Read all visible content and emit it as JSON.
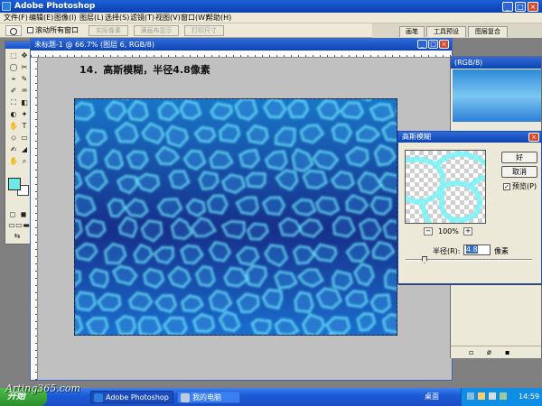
{
  "app": {
    "title": "Adobe Photoshop",
    "window_buttons": [
      "_",
      "□",
      "×"
    ]
  },
  "menu": {
    "items": [
      "文件(F)",
      "编辑(E)",
      "图像(I)",
      "图层(L)",
      "选择(S)",
      "滤镜(T)",
      "视图(V)",
      "窗口(W)",
      "帮助(H)"
    ]
  },
  "options_bar": {
    "checkbox_label": "滚动所有窗口",
    "buttons": [
      "实际像素",
      "满画布显示",
      "打印尺寸"
    ],
    "palette_tabs": [
      "画笔",
      "工具预设",
      "图层复合"
    ]
  },
  "document": {
    "title": "未标题-1 @ 66.7% (图层 6, RGB/8)",
    "caption": "14．高斯模糊，半径4.8像素"
  },
  "navigator": {
    "title": "(RGB/8)"
  },
  "dialog": {
    "title": "高斯模糊",
    "ok_label": "好",
    "cancel_label": "取消",
    "preview_label": "预览(P)",
    "preview_checked": true,
    "zoom_minus": "−",
    "zoom_plus": "+",
    "zoom_value": "100%",
    "radius_label": "半径(R):",
    "radius_value": "4.8",
    "radius_unit": "像素"
  },
  "taskbar": {
    "start_label": "开始",
    "tasks": [
      "Adobe Photoshop",
      "我的电脑"
    ],
    "tray_label": "桌面",
    "clock": "14:59"
  },
  "watermark": "Arting365.com",
  "colors": {
    "foreground": "#6ee8e6",
    "background": "#ffffff",
    "canvas_cell": "#2f86d6",
    "canvas_edge": "#6ff0ff"
  }
}
